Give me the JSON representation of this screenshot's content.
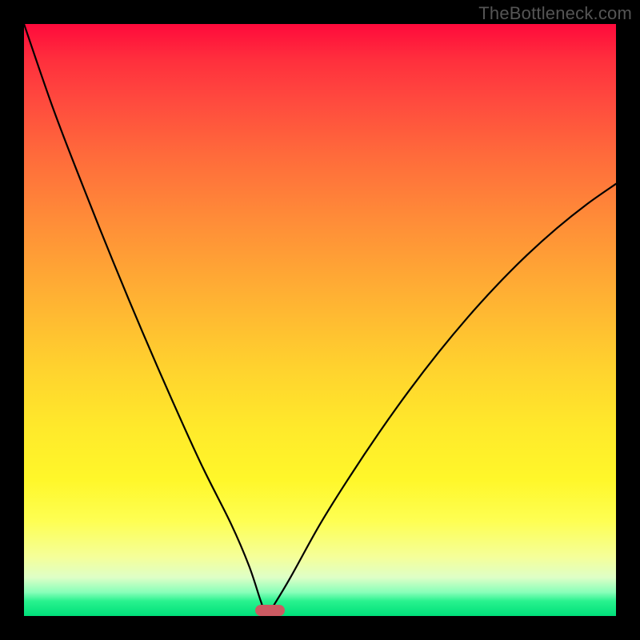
{
  "watermark": "TheBottleneck.com",
  "chart_data": {
    "type": "line",
    "title": "",
    "xlabel": "",
    "ylabel": "",
    "xlim": [
      0,
      100
    ],
    "ylim": [
      0,
      100
    ],
    "grid": false,
    "description": "Bottleneck-style V curve on red-yellow-green gradient. Curve reaches ~0 around x≈41; gradient maps value to color (red=high, green=low).",
    "series": [
      {
        "name": "curve",
        "x": [
          0,
          5,
          10,
          15,
          20,
          25,
          30,
          35,
          38,
          40,
          41,
          42,
          45,
          50,
          55,
          60,
          65,
          70,
          75,
          80,
          85,
          90,
          95,
          100
        ],
        "values": [
          100,
          85.5,
          72.5,
          60.0,
          48.0,
          36.5,
          25.5,
          15.5,
          8.5,
          2.5,
          0,
          1.5,
          6.5,
          15.5,
          23.5,
          31.0,
          38.0,
          44.5,
          50.5,
          56.0,
          61.0,
          65.5,
          69.5,
          73.0
        ]
      }
    ],
    "marker": {
      "x_range": [
        39,
        44
      ],
      "y": 0,
      "color": "#cc5a62"
    },
    "gradient_stops": [
      {
        "pos": 0.0,
        "color": "#ff0a3c"
      },
      {
        "pos": 0.06,
        "color": "#ff2f3d"
      },
      {
        "pos": 0.13,
        "color": "#ff4a3e"
      },
      {
        "pos": 0.22,
        "color": "#ff6a3b"
      },
      {
        "pos": 0.33,
        "color": "#ff8c38"
      },
      {
        "pos": 0.46,
        "color": "#ffb133"
      },
      {
        "pos": 0.58,
        "color": "#ffd22e"
      },
      {
        "pos": 0.68,
        "color": "#ffe92b"
      },
      {
        "pos": 0.77,
        "color": "#fff72a"
      },
      {
        "pos": 0.84,
        "color": "#feff53"
      },
      {
        "pos": 0.9,
        "color": "#f5ff99"
      },
      {
        "pos": 0.935,
        "color": "#deffc7"
      },
      {
        "pos": 0.96,
        "color": "#88ffb9"
      },
      {
        "pos": 0.975,
        "color": "#28f28e"
      },
      {
        "pos": 1.0,
        "color": "#00e07a"
      }
    ]
  }
}
